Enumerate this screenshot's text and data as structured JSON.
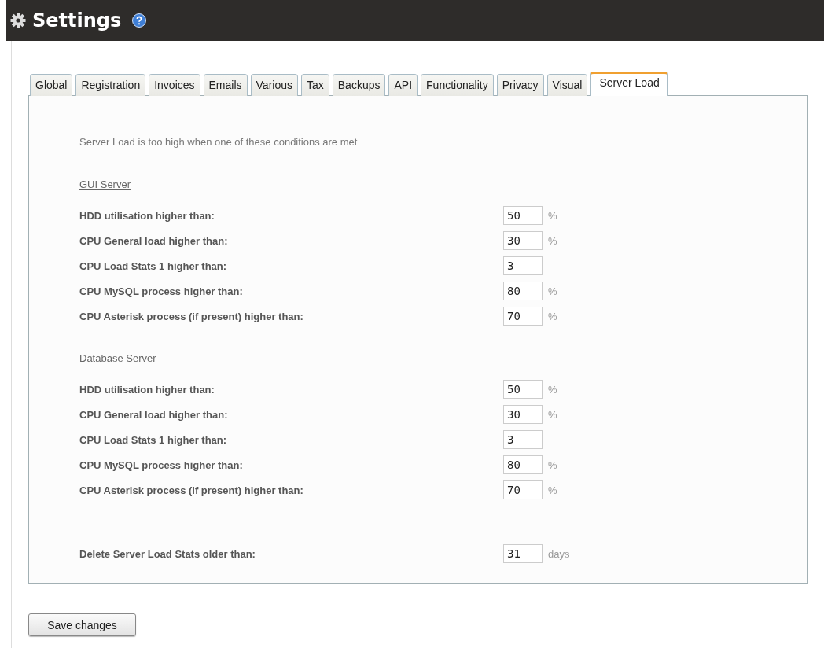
{
  "header": {
    "title": "Settings"
  },
  "tabs": [
    {
      "label": "Global",
      "selected": false
    },
    {
      "label": "Registration",
      "selected": false
    },
    {
      "label": "Invoices",
      "selected": false
    },
    {
      "label": "Emails",
      "selected": false
    },
    {
      "label": "Various",
      "selected": false
    },
    {
      "label": "Tax",
      "selected": false
    },
    {
      "label": "Backups",
      "selected": false
    },
    {
      "label": "API",
      "selected": false
    },
    {
      "label": "Functionality",
      "selected": false
    },
    {
      "label": "Privacy",
      "selected": false
    },
    {
      "label": "Visual",
      "selected": false
    },
    {
      "label": "Server Load",
      "selected": true
    }
  ],
  "intro": "Server Load is too high when one of these conditions are met",
  "sections": [
    {
      "heading": "GUI Server",
      "rows": [
        {
          "label": "HDD utilisation higher than:",
          "value": "50",
          "unit": "%"
        },
        {
          "label": "CPU General load higher than:",
          "value": "30",
          "unit": "%"
        },
        {
          "label": "CPU Load Stats 1 higher than:",
          "value": "3"
        },
        {
          "label": "CPU MySQL process higher than:",
          "value": "80",
          "unit": "%"
        },
        {
          "label": "CPU Asterisk process (if present) higher than:",
          "value": "70",
          "unit": "%"
        }
      ]
    },
    {
      "heading": "Database Server",
      "rows": [
        {
          "label": "HDD utilisation higher than:",
          "value": "50",
          "unit": "%"
        },
        {
          "label": "CPU General load higher than:",
          "value": "30",
          "unit": "%"
        },
        {
          "label": "CPU Load Stats 1 higher than:",
          "value": "3"
        },
        {
          "label": "CPU MySQL process higher than:",
          "value": "80",
          "unit": "%"
        },
        {
          "label": "CPU Asterisk process (if present) higher than:",
          "value": "70",
          "unit": "%"
        }
      ]
    }
  ],
  "retention": {
    "label": "Delete Server Load Stats older than:",
    "value": "31",
    "unit": "days"
  },
  "save_button": "Save changes"
}
